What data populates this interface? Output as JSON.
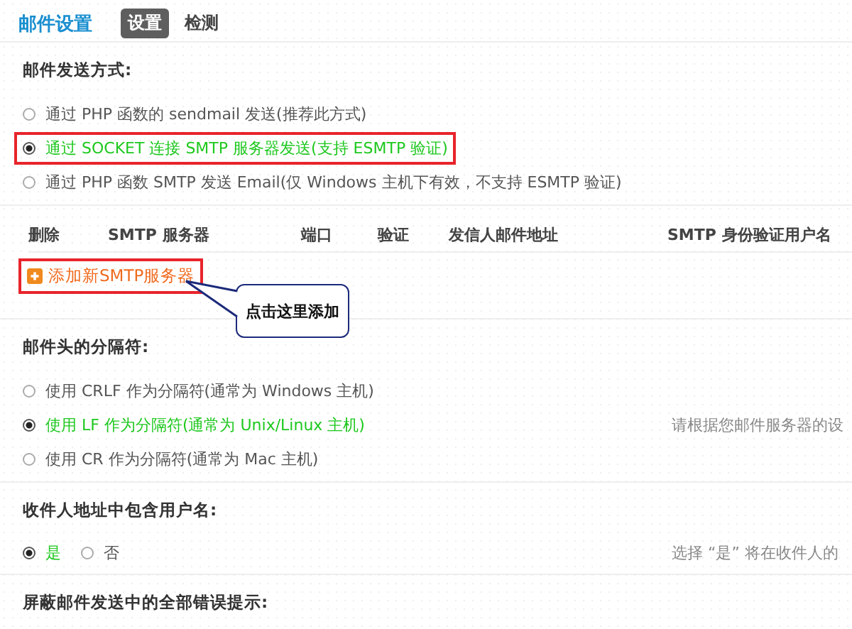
{
  "header": {
    "title": "邮件设置",
    "tabs": [
      {
        "label": "设置",
        "selected": true
      },
      {
        "label": "检测",
        "selected": false
      }
    ]
  },
  "sections": [
    {
      "kind": "radios",
      "title": "邮件发送方式:",
      "options": [
        {
          "label": "通过 PHP 函数的 sendmail 发送(推荐此方式)",
          "selected": false,
          "annotated": false
        },
        {
          "label": "通过 SOCKET 连接 SMTP 服务器发送(支持 ESMTP 验证)",
          "selected": true,
          "annotated": true
        },
        {
          "label": "通过 PHP 函数 SMTP 发送 Email(仅 Windows 主机下有效，不支持 ESMTP 验证)",
          "selected": false,
          "annotated": false
        }
      ]
    },
    {
      "kind": "table",
      "columns": [
        "删除",
        "SMTP 服务器",
        "端口",
        "验证",
        "发信人邮件地址",
        "SMTP 身份验证用户名"
      ],
      "add_button": {
        "label": "添加新SMTP服务器",
        "annotated": true
      },
      "callout": "点击这里添加"
    },
    {
      "kind": "radios",
      "title": "邮件头的分隔符:",
      "hint": "请根据您邮件服务器的设",
      "options": [
        {
          "label": "使用 CRLF 作为分隔符(通常为 Windows 主机)",
          "selected": false,
          "annotated": false
        },
        {
          "label": "使用 LF 作为分隔符(通常为 Unix/Linux 主机)",
          "selected": true,
          "annotated": false
        },
        {
          "label": "使用 CR 作为分隔符(通常为 Mac 主机)",
          "selected": false,
          "annotated": false
        }
      ]
    },
    {
      "kind": "inline-radios",
      "title": "收件人地址中包含用户名:",
      "hint": "选择 “是” 将在收件人的",
      "options": [
        {
          "label": "是",
          "selected": true
        },
        {
          "label": "否",
          "selected": false
        }
      ]
    },
    {
      "kind": "title-only",
      "title": "屏蔽邮件发送中的全部错误提示:"
    }
  ]
}
